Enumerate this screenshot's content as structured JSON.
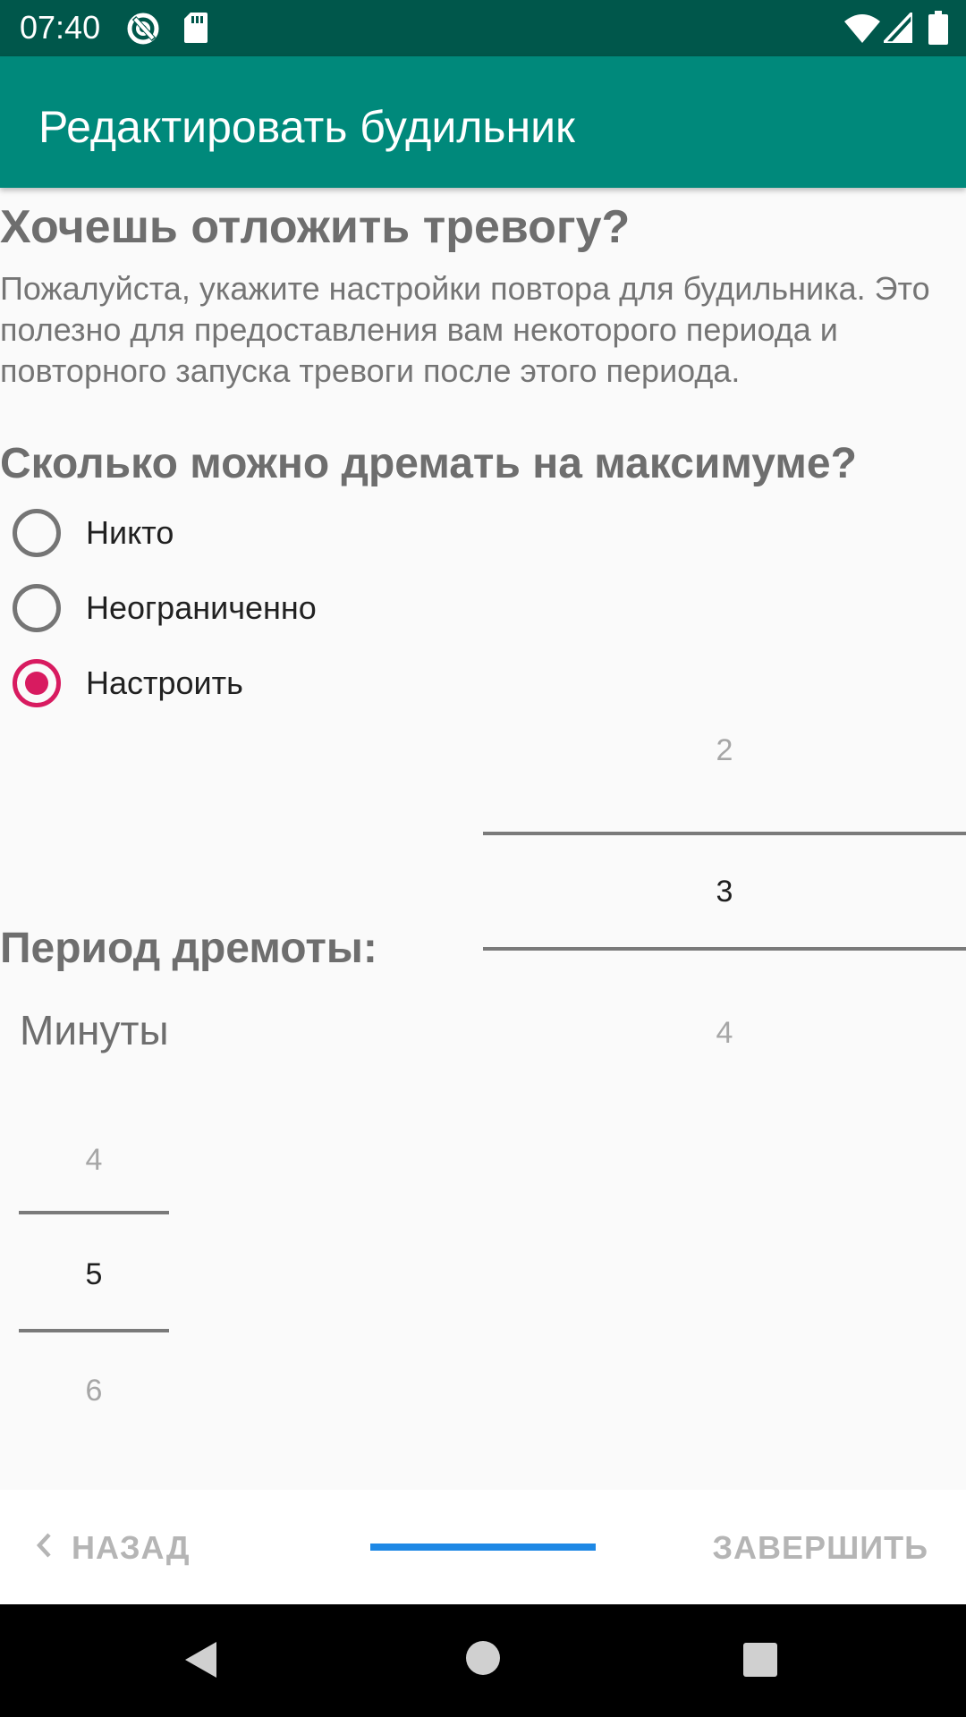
{
  "status_bar": {
    "time": "07:40",
    "icons": [
      "at-sign-icon",
      "sd-card-icon",
      "wifi-icon",
      "signal-icon",
      "battery-icon"
    ]
  },
  "app_bar": {
    "title": "Редактировать будильник"
  },
  "main": {
    "heading": "Хочешь отложить тревогу?",
    "description": "Пожалуйста, укажите настройки повтора для будильника. Это полезно для предоставления вам некоторого периода и повторного запуска тревоги после этого периода.",
    "max_snooze_heading": "Сколько можно дремать на максимуме?",
    "options": [
      {
        "label": "Никто",
        "checked": false
      },
      {
        "label": "Неограниченно",
        "checked": false
      },
      {
        "label": "Настроить",
        "checked": true
      }
    ],
    "count_picker": {
      "prev": "2",
      "selected": "3",
      "next": "4"
    },
    "period_heading": "Период дремоты:",
    "minutes_label": "Минуты",
    "minutes_picker": {
      "prev": "4",
      "selected": "5",
      "next": "6"
    }
  },
  "bottom_bar": {
    "back_label": "НАЗАД",
    "finish_label": "ЗАВЕРШИТЬ"
  },
  "colors": {
    "status_bar": "#00574b",
    "app_bar": "#00897b",
    "radio_accent": "#d81b60",
    "progress": "#1e88e5"
  },
  "nav_bar": {
    "icons": [
      "back-triangle-icon",
      "home-circle-icon",
      "recents-square-icon"
    ]
  }
}
